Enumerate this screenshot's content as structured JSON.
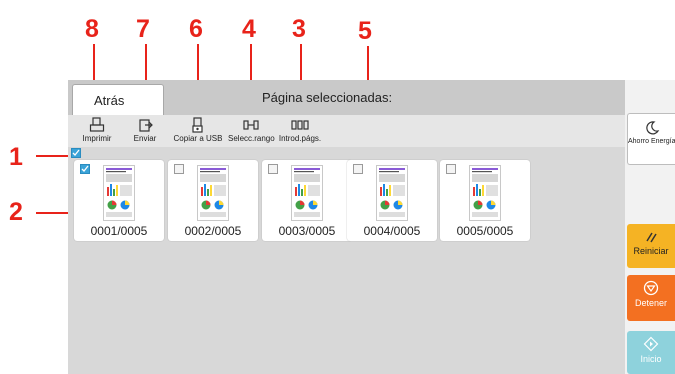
{
  "callouts": [
    "8",
    "7",
    "6",
    "4",
    "3",
    "5",
    "1",
    "2"
  ],
  "topbar": {
    "back_label": "Atrás",
    "page_status": "Página seleccionadas:"
  },
  "toolbar": {
    "items": [
      {
        "label": "Imprimir",
        "icon": "printer-icon"
      },
      {
        "label": "Enviar",
        "icon": "send-icon"
      },
      {
        "label": "Copiar a USB",
        "icon": "usb-copy-icon"
      },
      {
        "label": "Selecc.rango",
        "icon": "range-select-icon"
      },
      {
        "label": "Introd.págs.",
        "icon": "page-input-icon"
      }
    ]
  },
  "thumbnails": [
    {
      "number": "0001/0005",
      "checked": true
    },
    {
      "number": "0002/0005",
      "checked": false
    },
    {
      "number": "0003/0005",
      "checked": false
    },
    {
      "number": "0004/0005",
      "checked": false
    },
    {
      "number": "0005/0005",
      "checked": false
    }
  ],
  "right_panel": {
    "energy_saver": "Ahorro Energía",
    "reset": "Reiniciar",
    "stop": "Detener",
    "start": "Inicio"
  },
  "colors": {
    "callout": "#e8231a",
    "checkbox_checked": "#3aa3d8",
    "reset": "#f5b324",
    "stop": "#f37021",
    "start": "#8ed2dc"
  }
}
